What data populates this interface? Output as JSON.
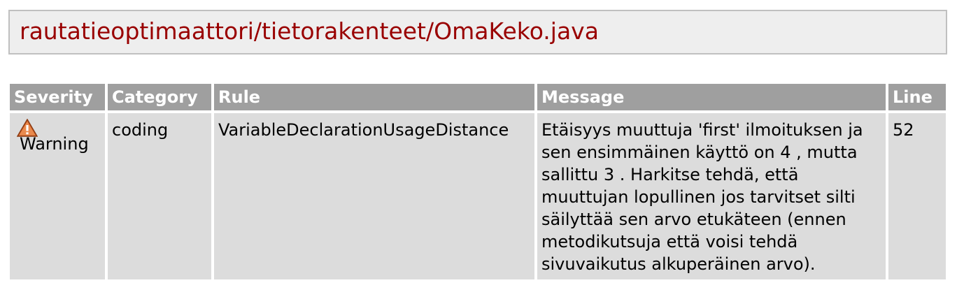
{
  "file": {
    "path": "rautatieoptimaattori/tietorakenteet/OmaKeko.java"
  },
  "table": {
    "headers": {
      "severity": "Severity",
      "category": "Category",
      "rule": "Rule",
      "message": "Message",
      "line": "Line"
    },
    "rows": [
      {
        "severity_icon": "warning-icon",
        "severity": "Warning",
        "category": "coding",
        "rule": "VariableDeclarationUsageDistance",
        "message": "Etäisyys muuttuja 'first' ilmoituksen ja sen ensimmäinen käyttö on 4 , mutta sallittu 3 . Harkitse tehdä, että muuttujan lopullinen jos tarvitset silti säilyttää sen arvo etukäteen (ennen metodikutsuja että voisi tehdä sivuvaikutus alkuperäinen arvo).",
        "line": "52"
      }
    ]
  },
  "colors": {
    "title_text": "#990000",
    "header_bg": "#9f9f9f",
    "cell_bg": "#dcdcdc",
    "warning_icon": "#d4652a"
  }
}
